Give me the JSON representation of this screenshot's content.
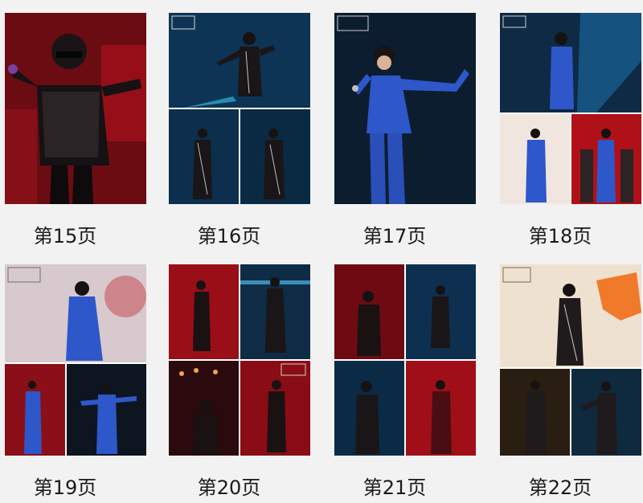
{
  "pages": [
    {
      "label": "第15页"
    },
    {
      "label": "第16页"
    },
    {
      "label": "第17页"
    },
    {
      "label": "第18页"
    },
    {
      "label": "第19页"
    },
    {
      "label": "第20页"
    },
    {
      "label": "第21页"
    },
    {
      "label": "第22页"
    }
  ],
  "colors": {
    "background": "#f2f2f2",
    "label_text": "#1a1a1a",
    "stage_red": "#8c1019",
    "stage_blue": "#0d3f66",
    "sequin_blue": "#2e57c9"
  }
}
